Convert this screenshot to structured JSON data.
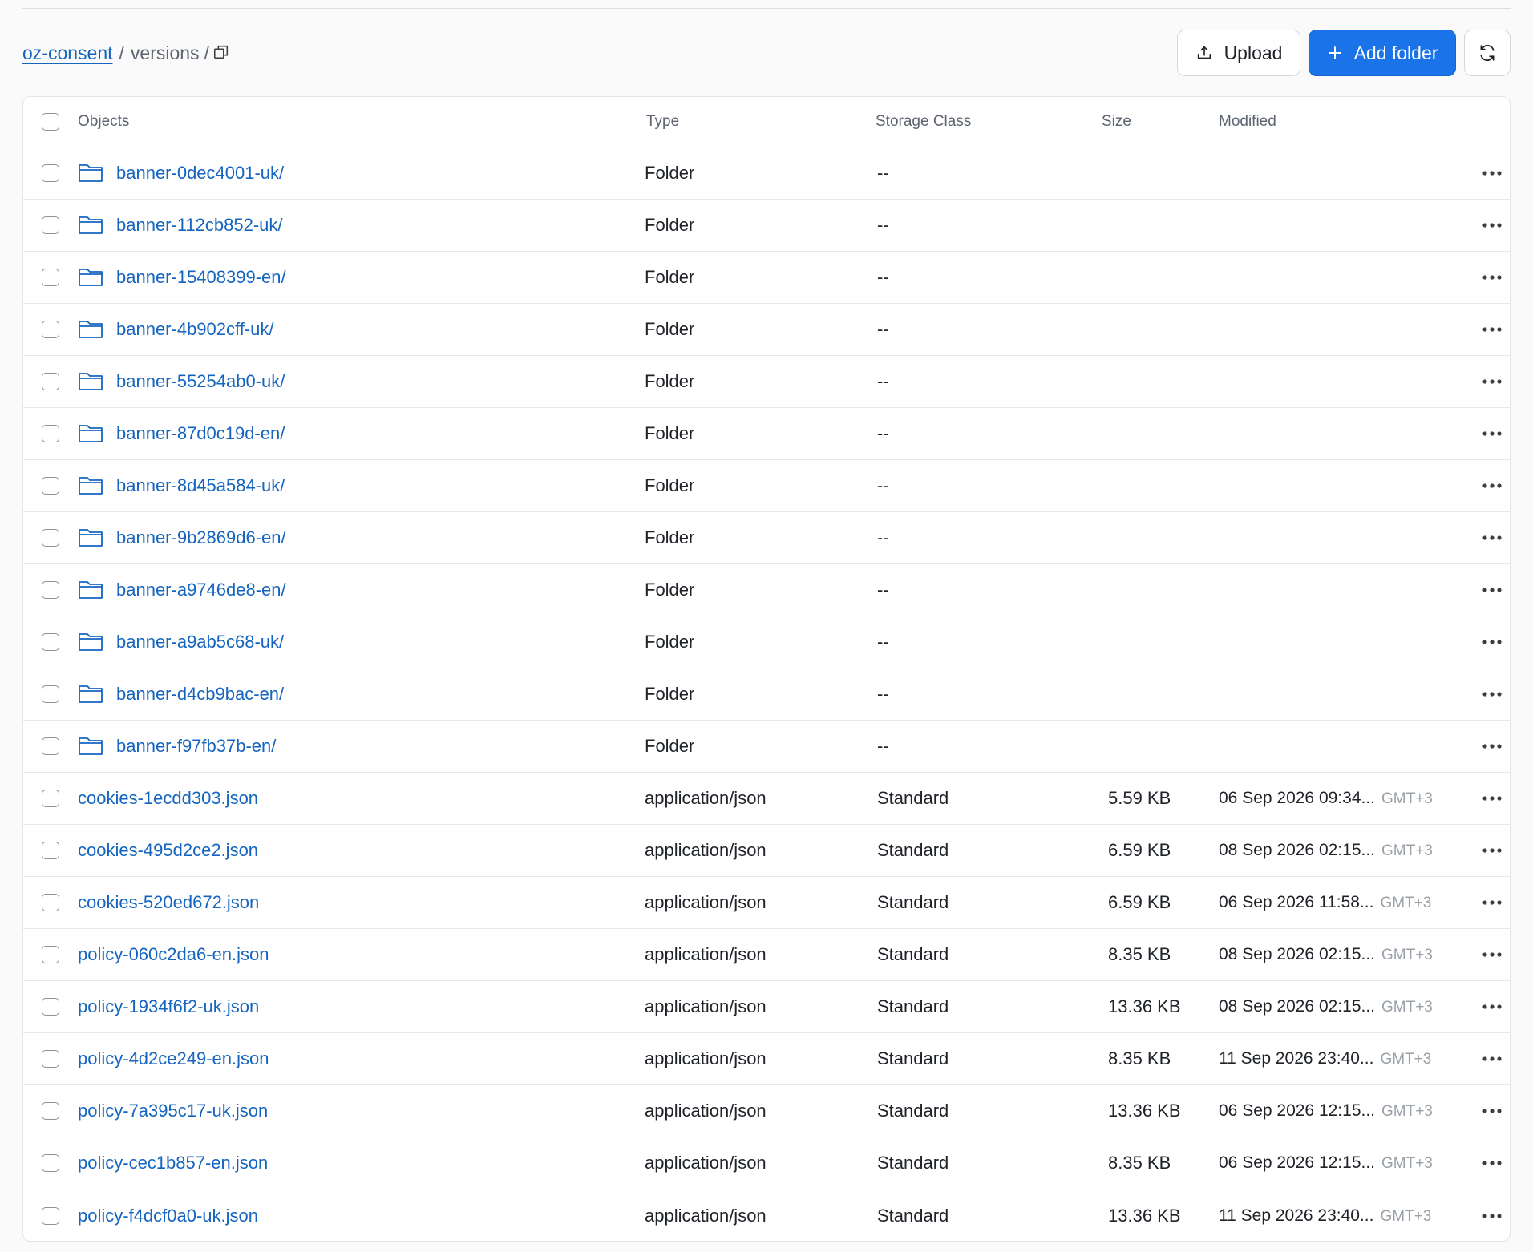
{
  "breadcrumb": {
    "root": "oz-consent",
    "separator": "/",
    "current": "versions",
    "trailing_separator": "/"
  },
  "toolbar": {
    "upload_label": "Upload",
    "add_folder_label": "Add folder",
    "upload_icon": "upload-icon",
    "add_icon": "plus-icon",
    "refresh_icon": "refresh-icon"
  },
  "colors": {
    "primary": "#1a73e8",
    "link": "#1565c0",
    "muted": "#5c6470",
    "timezone": "#9aa0a7"
  },
  "table": {
    "columns": [
      "Objects",
      "Type",
      "Storage Class",
      "Size",
      "Modified"
    ],
    "rows": [
      {
        "name": "banner-0dec4001-uk/",
        "kind": "folder",
        "type": "Folder",
        "storage": "--",
        "size": "",
        "modified": "",
        "tz": ""
      },
      {
        "name": "banner-112cb852-uk/",
        "kind": "folder",
        "type": "Folder",
        "storage": "--",
        "size": "",
        "modified": "",
        "tz": ""
      },
      {
        "name": "banner-15408399-en/",
        "kind": "folder",
        "type": "Folder",
        "storage": "--",
        "size": "",
        "modified": "",
        "tz": ""
      },
      {
        "name": "banner-4b902cff-uk/",
        "kind": "folder",
        "type": "Folder",
        "storage": "--",
        "size": "",
        "modified": "",
        "tz": ""
      },
      {
        "name": "banner-55254ab0-uk/",
        "kind": "folder",
        "type": "Folder",
        "storage": "--",
        "size": "",
        "modified": "",
        "tz": ""
      },
      {
        "name": "banner-87d0c19d-en/",
        "kind": "folder",
        "type": "Folder",
        "storage": "--",
        "size": "",
        "modified": "",
        "tz": ""
      },
      {
        "name": "banner-8d45a584-uk/",
        "kind": "folder",
        "type": "Folder",
        "storage": "--",
        "size": "",
        "modified": "",
        "tz": ""
      },
      {
        "name": "banner-9b2869d6-en/",
        "kind": "folder",
        "type": "Folder",
        "storage": "--",
        "size": "",
        "modified": "",
        "tz": ""
      },
      {
        "name": "banner-a9746de8-en/",
        "kind": "folder",
        "type": "Folder",
        "storage": "--",
        "size": "",
        "modified": "",
        "tz": ""
      },
      {
        "name": "banner-a9ab5c68-uk/",
        "kind": "folder",
        "type": "Folder",
        "storage": "--",
        "size": "",
        "modified": "",
        "tz": ""
      },
      {
        "name": "banner-d4cb9bac-en/",
        "kind": "folder",
        "type": "Folder",
        "storage": "--",
        "size": "",
        "modified": "",
        "tz": ""
      },
      {
        "name": "banner-f97fb37b-en/",
        "kind": "folder",
        "type": "Folder",
        "storage": "--",
        "size": "",
        "modified": "",
        "tz": ""
      },
      {
        "name": "cookies-1ecdd303.json",
        "kind": "file",
        "type": "application/json",
        "storage": "Standard",
        "size": "5.59 KB",
        "modified": "06 Sep 2026 09:34...",
        "tz": "GMT+3"
      },
      {
        "name": "cookies-495d2ce2.json",
        "kind": "file",
        "type": "application/json",
        "storage": "Standard",
        "size": "6.59 KB",
        "modified": "08 Sep 2026 02:15...",
        "tz": "GMT+3"
      },
      {
        "name": "cookies-520ed672.json",
        "kind": "file",
        "type": "application/json",
        "storage": "Standard",
        "size": "6.59 KB",
        "modified": "06 Sep 2026 11:58...",
        "tz": "GMT+3"
      },
      {
        "name": "policy-060c2da6-en.json",
        "kind": "file",
        "type": "application/json",
        "storage": "Standard",
        "size": "8.35 KB",
        "modified": "08 Sep 2026 02:15...",
        "tz": "GMT+3"
      },
      {
        "name": "policy-1934f6f2-uk.json",
        "kind": "file",
        "type": "application/json",
        "storage": "Standard",
        "size": "13.36 KB",
        "modified": "08 Sep 2026 02:15...",
        "tz": "GMT+3"
      },
      {
        "name": "policy-4d2ce249-en.json",
        "kind": "file",
        "type": "application/json",
        "storage": "Standard",
        "size": "8.35 KB",
        "modified": "11 Sep 2026 23:40...",
        "tz": "GMT+3"
      },
      {
        "name": "policy-7a395c17-uk.json",
        "kind": "file",
        "type": "application/json",
        "storage": "Standard",
        "size": "13.36 KB",
        "modified": "06 Sep 2026 12:15...",
        "tz": "GMT+3"
      },
      {
        "name": "policy-cec1b857-en.json",
        "kind": "file",
        "type": "application/json",
        "storage": "Standard",
        "size": "8.35 KB",
        "modified": "06 Sep 2026 12:15...",
        "tz": "GMT+3"
      },
      {
        "name": "policy-f4dcf0a0-uk.json",
        "kind": "file",
        "type": "application/json",
        "storage": "Standard",
        "size": "13.36 KB",
        "modified": "11 Sep 2026 23:40...",
        "tz": "GMT+3"
      }
    ]
  }
}
